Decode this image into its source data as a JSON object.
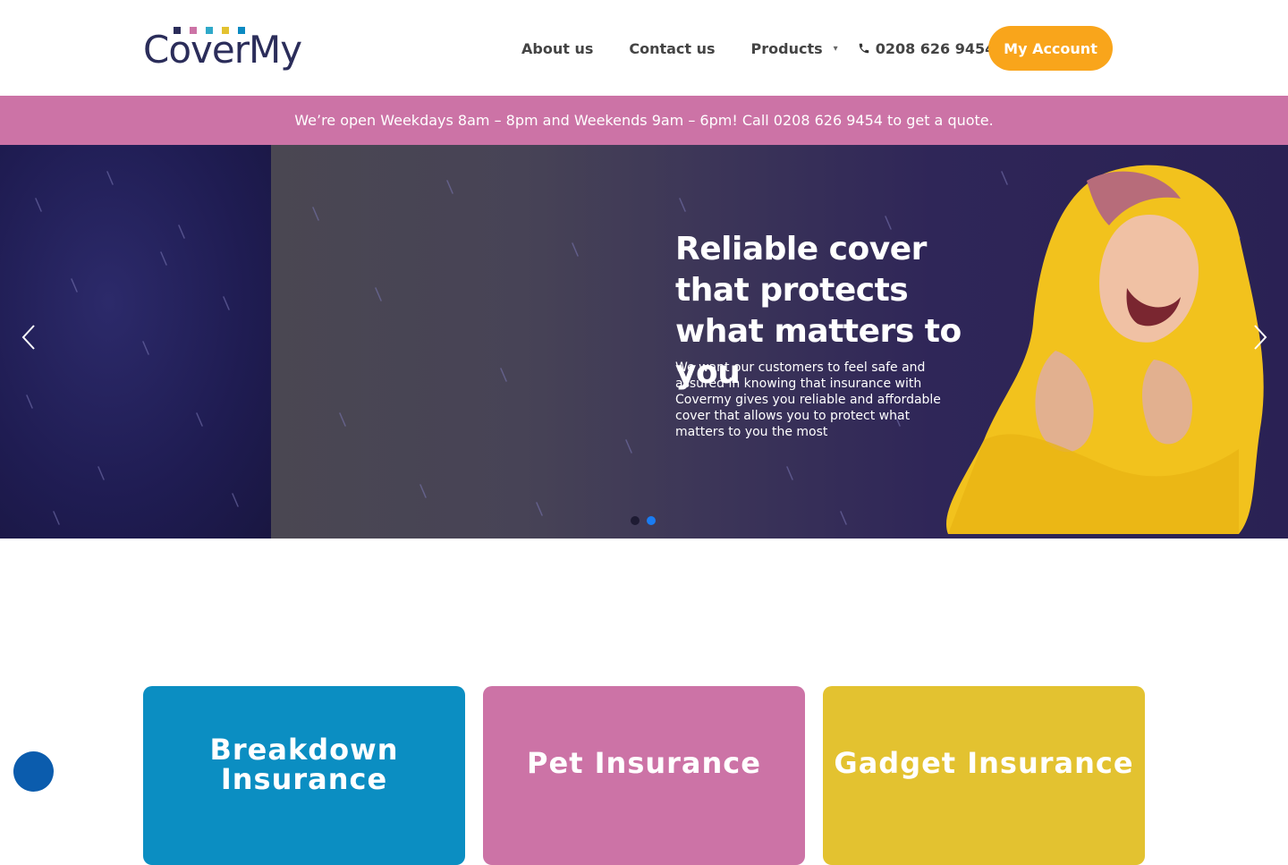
{
  "header": {
    "logo_text": "CoverMy",
    "logo_square_colors": [
      "#2b2d5a",
      "#cc73a6",
      "#2fa9c9",
      "#e3c230",
      "#0b8ac2"
    ],
    "nav": {
      "about": "About us",
      "contact": "Contact us",
      "products": "Products",
      "phone": "0208 626 9454"
    },
    "account_button": "My Account"
  },
  "banner": {
    "text": "We’re open Weekdays 8am – 8pm and Weekends 9am – 6pm! Call 0208 626 9454 to get a quote."
  },
  "hero": {
    "title": "Reliable cover that protects what matters to you",
    "subtitle": "We want our customers to feel safe and assured in knowing that insurance with Covermy gives you reliable and affordable cover that allows you to protect what matters to you the most",
    "active_slide": 2,
    "slide_count": 2
  },
  "cards": [
    {
      "label": "Breakdown Insurance",
      "color": "#0b8ec2"
    },
    {
      "label": "Pet Insurance",
      "color": "#cc73a6"
    },
    {
      "label": "Gadget Insurance",
      "color": "#e3c230"
    }
  ],
  "colors": {
    "accent": "#f9a51b",
    "banner": "#cc73a6",
    "chat": "#0b5cad"
  }
}
